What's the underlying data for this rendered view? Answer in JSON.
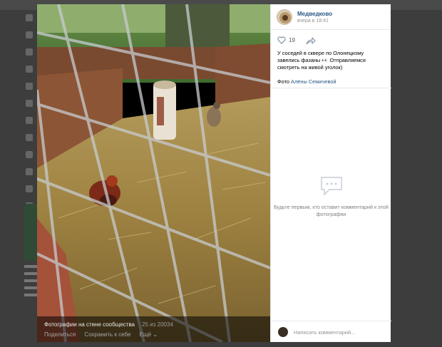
{
  "post": {
    "author": "Медведково",
    "time": "вчера в 18:41",
    "likes": "19",
    "text": "У соседей в сквере по Олонецкому завелись фазаны 👀 Отправляемся смотреть на живой уголок)",
    "photo_by_prefix": "Фото",
    "photo_by_name": "Алёны Семичевой"
  },
  "comments": {
    "empty_text": "Будьте первым, кто оставит комментарий к этой фотографии",
    "input_placeholder": "Написать комментарий..."
  },
  "album": {
    "title": "Фотографии на стене сообщества",
    "counter": "25 из 20034"
  },
  "actions": {
    "share": "Поделиться",
    "save": "Сохранить к себе",
    "more": "Ещё ⌄"
  },
  "colors": {
    "link": "#2a5885",
    "panel_bg": "#ffffff",
    "viewer_bg": "#000000"
  },
  "icons": [
    "heart-icon",
    "share-arrow-icon",
    "comment-bubble-icon",
    "community-logo"
  ]
}
